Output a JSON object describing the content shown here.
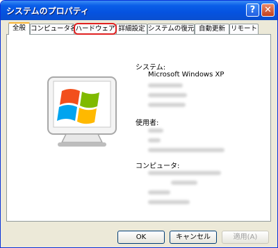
{
  "window": {
    "title": "システムのプロパティ",
    "help_label": "?",
    "close_label": "✕"
  },
  "tabs": [
    {
      "label": "全般"
    },
    {
      "label": "コンピュータ名"
    },
    {
      "label": "ハードウェア"
    },
    {
      "label": "詳細設定"
    },
    {
      "label": "システムの復元"
    },
    {
      "label": "自動更新"
    },
    {
      "label": "リモート"
    }
  ],
  "general": {
    "system_heading": "システム:",
    "os_name": "Microsoft Windows XP",
    "registered_heading": "使用者:",
    "computer_heading": "コンピュータ:"
  },
  "buttons": {
    "ok": "OK",
    "cancel": "キャンセル",
    "apply": "適用(A)"
  },
  "colors": {
    "titlebar": "#0a5ee8",
    "highlight": "#e02020",
    "active_tab_accent": "#f8b333"
  }
}
